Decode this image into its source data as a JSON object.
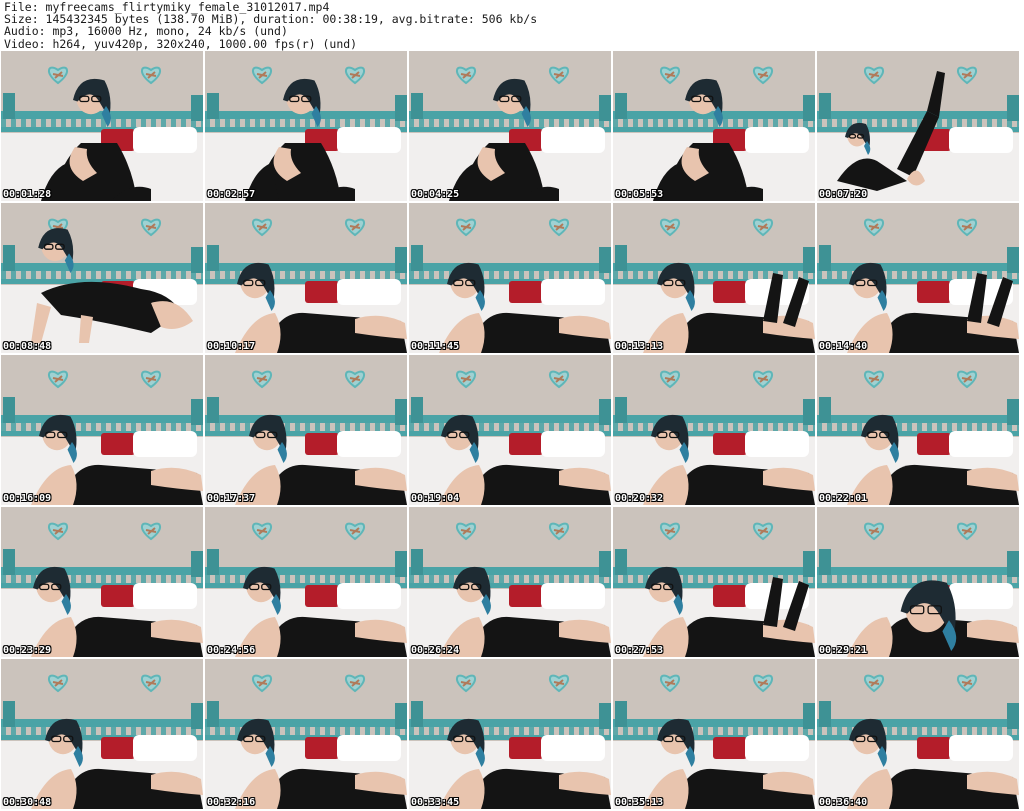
{
  "header": {
    "file_line": "File: myfreecams_flirtymiky_female_31012017.mp4",
    "size_line": "Size: 145432345 bytes (138.70 MiB), duration: 00:38:19, avg.bitrate: 506 kb/s",
    "audio_line": "Audio: mp3, 16000 Hz, mono, 24 kb/s (und)",
    "video_line": "Video: h264, yuv420p, 320x240, 1000.00 fps(r) (und)"
  },
  "colors": {
    "wall": "#cbc3bc",
    "headboard": "#4aa3a6",
    "bed": "#f1efee",
    "pillow_red": "#b41d2a",
    "outfit": "#141414",
    "skin": "#e8c4ae",
    "hair": "#1e2b33",
    "hair_tip": "#2f7fa0"
  },
  "thumbnails": [
    {
      "timestamp": "00:01:28",
      "pose": "sit"
    },
    {
      "timestamp": "00:02:57",
      "pose": "sit"
    },
    {
      "timestamp": "00:04:25",
      "pose": "sit"
    },
    {
      "timestamp": "00:05:53",
      "pose": "sit"
    },
    {
      "timestamp": "00:07:20",
      "pose": "legs"
    },
    {
      "timestamp": "00:08:48",
      "pose": "crawl"
    },
    {
      "timestamp": "00:10:17",
      "pose": "lie"
    },
    {
      "timestamp": "00:11:45",
      "pose": "lie"
    },
    {
      "timestamp": "00:13:13",
      "pose": "lie-legs"
    },
    {
      "timestamp": "00:14:40",
      "pose": "lie-legs"
    },
    {
      "timestamp": "00:16:09",
      "pose": "lie"
    },
    {
      "timestamp": "00:17:37",
      "pose": "lie"
    },
    {
      "timestamp": "00:19:04",
      "pose": "lie"
    },
    {
      "timestamp": "00:20:32",
      "pose": "lie"
    },
    {
      "timestamp": "00:22:01",
      "pose": "lie"
    },
    {
      "timestamp": "00:23:29",
      "pose": "lie"
    },
    {
      "timestamp": "00:24:56",
      "pose": "lie"
    },
    {
      "timestamp": "00:26:24",
      "pose": "lie"
    },
    {
      "timestamp": "00:27:53",
      "pose": "lie-legs"
    },
    {
      "timestamp": "00:29:21",
      "pose": "lie-close"
    },
    {
      "timestamp": "00:30:48",
      "pose": "lie"
    },
    {
      "timestamp": "00:32:16",
      "pose": "lie"
    },
    {
      "timestamp": "00:33:45",
      "pose": "lie"
    },
    {
      "timestamp": "00:35:13",
      "pose": "lie"
    },
    {
      "timestamp": "00:36:40",
      "pose": "lie"
    }
  ]
}
